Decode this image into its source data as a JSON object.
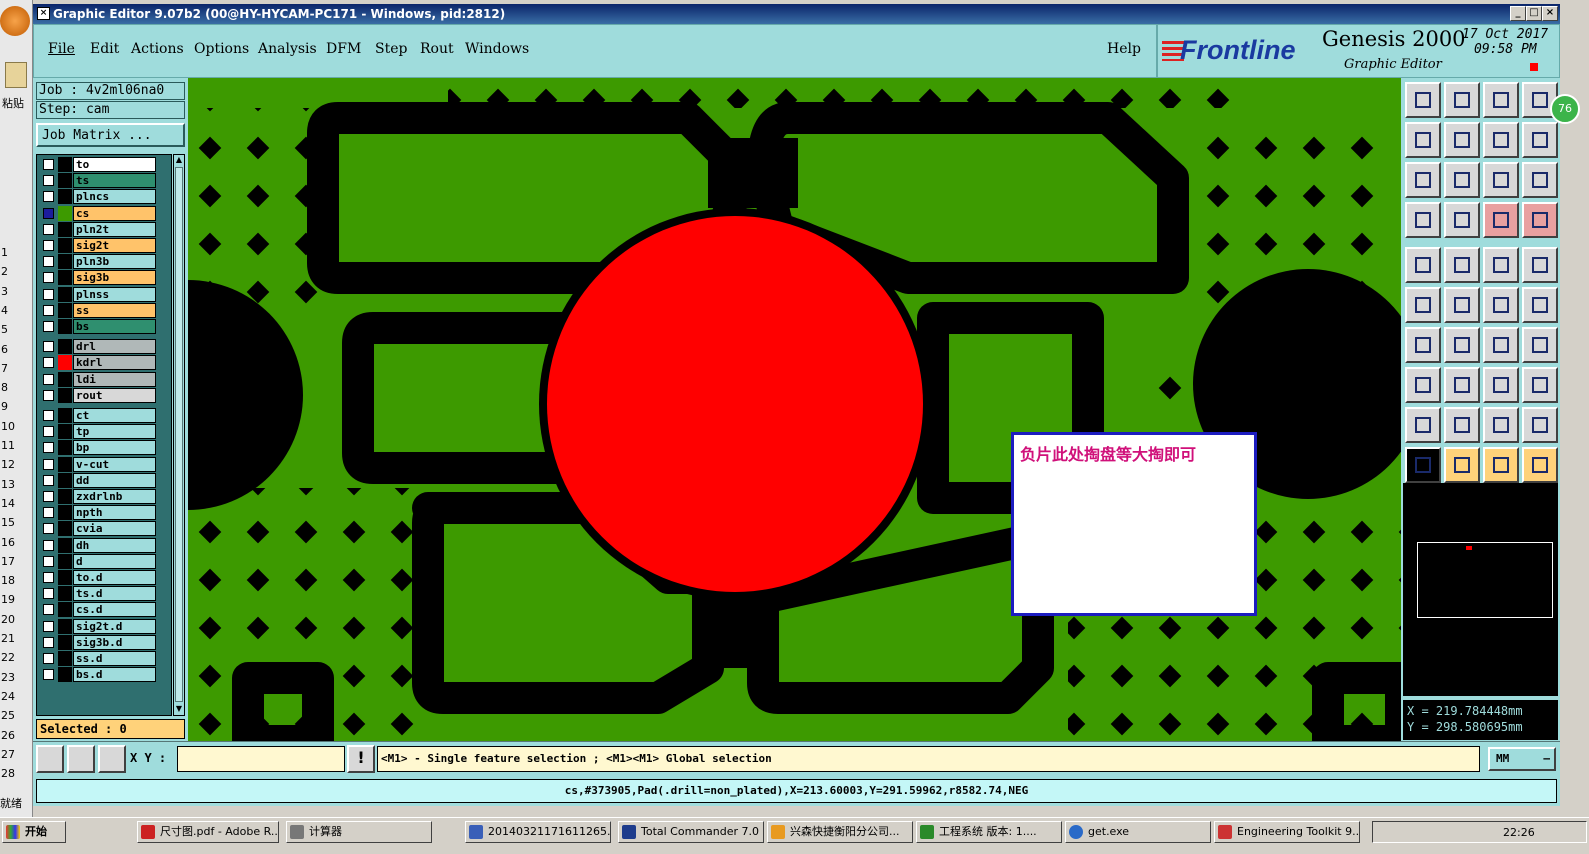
{
  "window": {
    "title": "Graphic Editor 9.07b2 (00@HY-HYCAM-PC171 - Windows, pid:2812)"
  },
  "excel": {
    "paste_label": "粘贴",
    "rows": [
      "1",
      "2",
      "3",
      "4",
      "5",
      "6",
      "7",
      "8",
      "9",
      "10",
      "11",
      "12",
      "13",
      "14",
      "15",
      "16",
      "17",
      "18",
      "19",
      "20",
      "21",
      "22",
      "23",
      "24",
      "25",
      "26",
      "27",
      "28"
    ],
    "ready": "就绪"
  },
  "menu": {
    "items": [
      "File",
      "Edit",
      "Actions",
      "Options",
      "Analysis",
      "DFM",
      "Step",
      "Rout",
      "Windows"
    ],
    "help": "Help"
  },
  "brand": {
    "logo": "Frontline",
    "product": "Genesis 2000",
    "subtitle": "Graphic Editor",
    "date": "17 Oct 2017",
    "time": "09:58 PM"
  },
  "job": {
    "job_line": "Job : 4v2ml06na0",
    "step_line": "Step: cam",
    "matrix_button": "Job Matrix ..."
  },
  "layers": [
    {
      "name": "to",
      "bg": "#ffffff",
      "color": "#000000"
    },
    {
      "name": "ts",
      "bg": "#2f8f6f",
      "color": "#000000"
    },
    {
      "name": "plncs",
      "bg": "#9fdcdc",
      "color": "#000000"
    },
    {
      "name": "cs",
      "bg": "#ffc36a",
      "color": "#3d9a00",
      "active": true
    },
    {
      "name": "pln2t",
      "bg": "#9fdcdc",
      "color": "#000000"
    },
    {
      "name": "sig2t",
      "bg": "#ffc36a",
      "color": "#000000"
    },
    {
      "name": "pln3b",
      "bg": "#9fdcdc",
      "color": "#000000"
    },
    {
      "name": "sig3b",
      "bg": "#ffc36a",
      "color": "#000000"
    },
    {
      "name": "plnss",
      "bg": "#9fdcdc",
      "color": "#000000"
    },
    {
      "name": "ss",
      "bg": "#ffc36a",
      "color": "#000000"
    },
    {
      "name": "bs",
      "bg": "#2f8f6f",
      "color": "#000000"
    },
    {
      "name": "drl",
      "bg": "#b0b8b8",
      "color": "#000000"
    },
    {
      "name": "kdrl",
      "bg": "#b0b8b8",
      "color": "#ff0000"
    },
    {
      "name": "ldi",
      "bg": "#b0b8b8",
      "color": "#000000"
    },
    {
      "name": "rout",
      "bg": "#d8d8d8",
      "color": "#000000"
    },
    {
      "name": "ct",
      "bg": "#9fdcdc",
      "color": "#000000"
    },
    {
      "name": "tp",
      "bg": "#9fdcdc",
      "color": "#000000"
    },
    {
      "name": "bp",
      "bg": "#9fdcdc",
      "color": "#000000"
    },
    {
      "name": "v-cut",
      "bg": "#9fdcdc",
      "color": "#000000"
    },
    {
      "name": "dd",
      "bg": "#9fdcdc",
      "color": "#000000"
    },
    {
      "name": "zxdrlnb",
      "bg": "#9fdcdc",
      "color": "#000000"
    },
    {
      "name": "npth",
      "bg": "#9fdcdc",
      "color": "#000000"
    },
    {
      "name": "cvia",
      "bg": "#9fdcdc",
      "color": "#000000"
    },
    {
      "name": "dh",
      "bg": "#9fdcdc",
      "color": "#000000"
    },
    {
      "name": "d",
      "bg": "#9fdcdc",
      "color": "#000000"
    },
    {
      "name": "to.d",
      "bg": "#9fdcdc",
      "color": "#000000"
    },
    {
      "name": "ts.d",
      "bg": "#9fdcdc",
      "color": "#000000"
    },
    {
      "name": "cs.d",
      "bg": "#9fdcdc",
      "color": "#000000"
    },
    {
      "name": "sig2t.d",
      "bg": "#9fdcdc",
      "color": "#000000"
    },
    {
      "name": "sig3b.d",
      "bg": "#9fdcdc",
      "color": "#000000"
    },
    {
      "name": "ss.d",
      "bg": "#9fdcdc",
      "color": "#000000"
    },
    {
      "name": "bs.d",
      "bg": "#9fdcdc",
      "color": "#000000"
    }
  ],
  "selected": "Selected : 0",
  "annotation": {
    "text": "负片此处掏盘等大掏即可"
  },
  "coords": {
    "x": "X = 219.784448mm",
    "y": "Y = 298.580695mm"
  },
  "cmd": {
    "xy_label": "X Y :",
    "xy_value": "",
    "hint": "<M1> - Single feature selection ; <M1><M1> Global selection",
    "units": "MM"
  },
  "status": {
    "text": "cs,#373905,Pad(.drill=non_plated),X=213.60003,Y=291.59962,r8582.74,NEG"
  },
  "badge": "76",
  "taskbar": {
    "start": "开始",
    "tasks": [
      "尺寸图.pdf - Adobe R...",
      "计算器",
      "20140321171611265....",
      "Total Commander 7.0 ...",
      "兴森快捷衡阳分公司...",
      "工程系统  版本: 1....",
      "get.exe",
      "Engineering Toolkit 9...."
    ],
    "clock": "22:26"
  },
  "colors": {
    "board": "#3d9a00",
    "pad": "#ff0000",
    "panel": "#9fdcdc",
    "highlight": "#ffc36a"
  }
}
